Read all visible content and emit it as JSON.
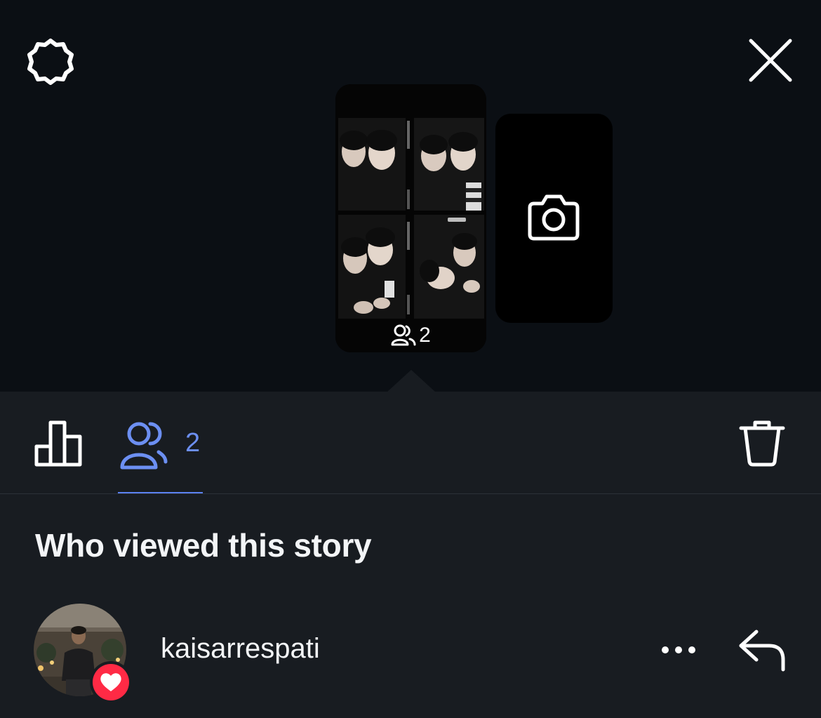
{
  "header": {
    "settings_icon": "settings-gear-icon",
    "close_icon": "close-icon"
  },
  "story": {
    "viewers_icon": "people-icon",
    "viewer_count": "2"
  },
  "new_story": {
    "icon": "camera-icon"
  },
  "tabs": {
    "insights_icon": "bar-chart-icon",
    "viewers_icon": "people-icon",
    "viewers_count": "2",
    "delete_icon": "trash-icon",
    "active": "viewers"
  },
  "section": {
    "title": "Who viewed this story"
  },
  "viewers": [
    {
      "username": "kaisarrespati",
      "reaction": "heart-icon",
      "more_icon": "more-icon",
      "reply_icon": "reply-icon"
    }
  ],
  "colors": {
    "background_top": "#0b0f14",
    "background_sheet": "#181c21",
    "accent_blue": "#6c8ff2",
    "like_red": "#ff2a45",
    "text_primary": "#f3f5f7"
  }
}
